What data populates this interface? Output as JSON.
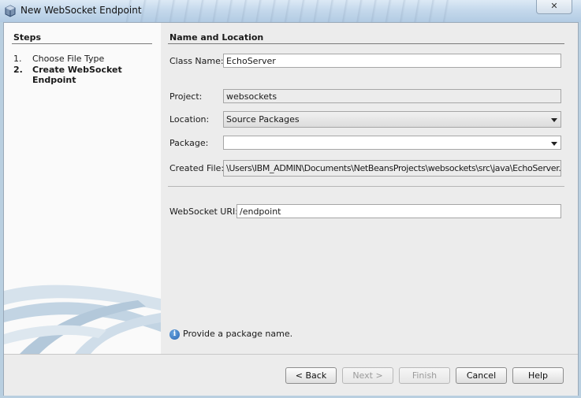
{
  "window": {
    "title": "New WebSocket Endpoint"
  },
  "steps": {
    "header": "Steps",
    "items": [
      {
        "num": "1.",
        "label": "Choose File Type"
      },
      {
        "num": "2.",
        "label": "Create WebSocket Endpoint"
      }
    ]
  },
  "content": {
    "section_title": "Name and Location",
    "class_name": {
      "label": "Class Name:",
      "value": "EchoServer"
    },
    "project": {
      "label": "Project:",
      "value": "websockets"
    },
    "location": {
      "label": "Location:",
      "value": "Source Packages"
    },
    "package": {
      "label": "Package:",
      "value": ""
    },
    "created_file": {
      "label": "Created File:",
      "value": "\\Users\\IBM_ADMIN\\Documents\\NetBeansProjects\\websockets\\src\\java\\EchoServer.java"
    },
    "websocket_uri": {
      "label": "WebSocket URI:",
      "value": "/endpoint"
    },
    "hint": "Provide a package name."
  },
  "buttons": {
    "back": "< Back",
    "next": "Next >",
    "finish": "Finish",
    "cancel": "Cancel",
    "help": "Help"
  }
}
